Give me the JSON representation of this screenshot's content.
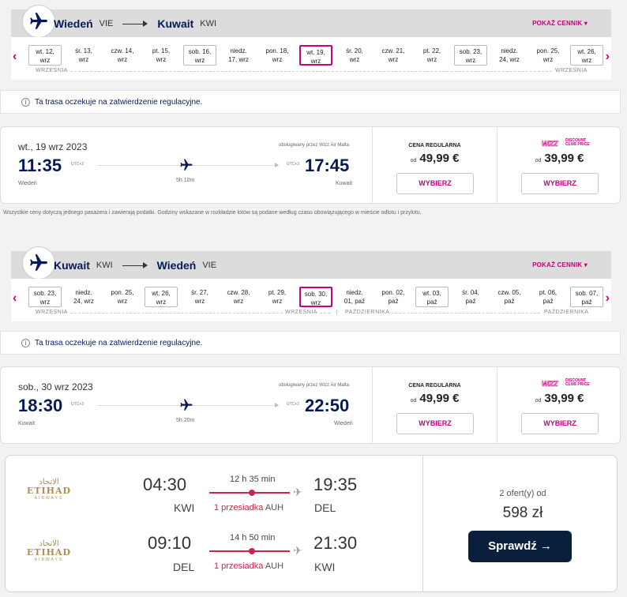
{
  "outbound": {
    "route": {
      "from_city": "Wiedeń",
      "from_code": "VIE",
      "to_city": "Kuwait",
      "to_code": "KWI",
      "price_link": "POKAŻ CENNIK ▾"
    },
    "days": [
      {
        "l1": "wt. 12,",
        "l2": "wrz",
        "style": "boxed"
      },
      {
        "l1": "śr. 13,",
        "l2": "wrz",
        "style": ""
      },
      {
        "l1": "czw. 14,",
        "l2": "wrz",
        "style": ""
      },
      {
        "l1": "pt. 15,",
        "l2": "wrz",
        "style": ""
      },
      {
        "l1": "sob. 16,",
        "l2": "wrz",
        "style": "boxed"
      },
      {
        "l1": "niedz.",
        "l2": "17, wrz",
        "style": ""
      },
      {
        "l1": "pon. 18,",
        "l2": "wrz",
        "style": ""
      },
      {
        "l1": "wt. 19,",
        "l2": "wrz",
        "style": "sel"
      },
      {
        "l1": "śr. 20,",
        "l2": "wrz",
        "style": ""
      },
      {
        "l1": "czw. 21,",
        "l2": "wrz",
        "style": ""
      },
      {
        "l1": "pt. 22,",
        "l2": "wrz",
        "style": ""
      },
      {
        "l1": "sob. 23,",
        "l2": "wrz",
        "style": "boxed"
      },
      {
        "l1": "niedz.",
        "l2": "24, wrz",
        "style": ""
      },
      {
        "l1": "pon. 25,",
        "l2": "wrz",
        "style": ""
      },
      {
        "l1": "wt. 26,",
        "l2": "wrz",
        "style": "boxed"
      }
    ],
    "months": {
      "left": "WRZEŚNIA",
      "right": "WRZEŚNIA"
    },
    "notice": "Ta trasa oczekuje na zatwierdzenie regulacyjne.",
    "flight": {
      "date": "wt., 19 wrz 2023",
      "operated": "obsługiwany przez Wizz Air Malta",
      "dep_time": "11:35",
      "dep_utc": "UTC+2",
      "dep_city": "Wiedeń",
      "arr_time": "17:45",
      "arr_utc": "UTC+3",
      "arr_city": "Kuwait",
      "duration": "5h 10m"
    },
    "fare_regular": {
      "label": "CENA REGULARNA",
      "od": "od",
      "price": "49,99 €",
      "button": "WYBIERZ"
    },
    "fare_club": {
      "brand": "WIZZ",
      "brand_sub1": "DISCOUNT",
      "brand_sub2": "CLUB PRICE",
      "od": "od",
      "price": "39,99 €",
      "button": "WYBIERZ"
    }
  },
  "footnote": "Wszystkie ceny dotyczą jednego pasażera i zawierają podatki. Godziny wskazane w rozkładzie lotów są podane według czasu obowiązującego w mieście odlotu i przylotu.",
  "inbound": {
    "route": {
      "from_city": "Kuwait",
      "from_code": "KWI",
      "to_city": "Wiedeń",
      "to_code": "VIE",
      "price_link": "POKAŻ CENNIK ▾"
    },
    "days": [
      {
        "l1": "sob. 23,",
        "l2": "wrz",
        "style": "boxed"
      },
      {
        "l1": "niedz.",
        "l2": "24, wrz",
        "style": ""
      },
      {
        "l1": "pon. 25,",
        "l2": "wrz",
        "style": ""
      },
      {
        "l1": "wt. 26,",
        "l2": "wrz",
        "style": "boxed"
      },
      {
        "l1": "śr. 27,",
        "l2": "wrz",
        "style": ""
      },
      {
        "l1": "czw. 28,",
        "l2": "wrz",
        "style": ""
      },
      {
        "l1": "pt. 29,",
        "l2": "wrz",
        "style": ""
      },
      {
        "l1": "sob. 30,",
        "l2": "wrz",
        "style": "sel"
      },
      {
        "l1": "niedz.",
        "l2": "01, paź",
        "style": ""
      },
      {
        "l1": "pon. 02,",
        "l2": "paź",
        "style": ""
      },
      {
        "l1": "wt. 03,",
        "l2": "paź",
        "style": "boxed"
      },
      {
        "l1": "śr. 04,",
        "l2": "paź",
        "style": ""
      },
      {
        "l1": "czw. 05,",
        "l2": "paź",
        "style": ""
      },
      {
        "l1": "pt. 06,",
        "l2": "paź",
        "style": ""
      },
      {
        "l1": "sob. 07,",
        "l2": "paź",
        "style": "boxed"
      }
    ],
    "months": {
      "left": "WRZEŚNIA",
      "mid_left": "WRZEŚNIA",
      "mid_right": "PAŹDZIERNIKA",
      "right": "PAŹDZIERNIKA"
    },
    "notice": "Ta trasa oczekuje na zatwierdzenie regulacyjne.",
    "flight": {
      "date": "sob., 30 wrz 2023",
      "operated": "obsługiwany przez Wizz Air Malta",
      "dep_time": "18:30",
      "dep_utc": "UTC+3",
      "dep_city": "Kuwait",
      "arr_time": "22:50",
      "arr_utc": "UTC+2",
      "arr_city": "Wiedeń",
      "duration": "5h 20m"
    },
    "fare_regular": {
      "label": "CENA REGULARNA",
      "od": "od",
      "price": "49,99 €",
      "button": "WYBIERZ"
    },
    "fare_club": {
      "brand": "WIZZ",
      "brand_sub1": "DISCOUNT",
      "brand_sub2": "CLUB PRICE",
      "od": "od",
      "price": "39,99 €",
      "button": "WYBIERZ"
    }
  },
  "offer": {
    "airline_ar": "الاتحاد",
    "airline_en": "ETIHAD",
    "airline_sub": "AIRWAYS",
    "legs": [
      {
        "dep_time": "04:30",
        "dep_code": "KWI",
        "arr_time": "19:35",
        "arr_code": "DEL",
        "duration": "12 h 35 min",
        "stops": "1 przesiadka",
        "via": "AUH"
      },
      {
        "dep_time": "09:10",
        "dep_code": "DEL",
        "arr_time": "21:30",
        "arr_code": "KWI",
        "duration": "14 h 50 min",
        "stops": "1 przesiadka",
        "via": "AUH"
      }
    ],
    "offers_count": "2 ofert(y) od",
    "price": "598 zł",
    "button": "Sprawdź →"
  },
  "colors": {
    "wizz_navy": "#061a57",
    "wizz_magenta": "#c6007e",
    "kiwi_red": "#c6284c",
    "kiwi_button": "#0a1f3c"
  }
}
